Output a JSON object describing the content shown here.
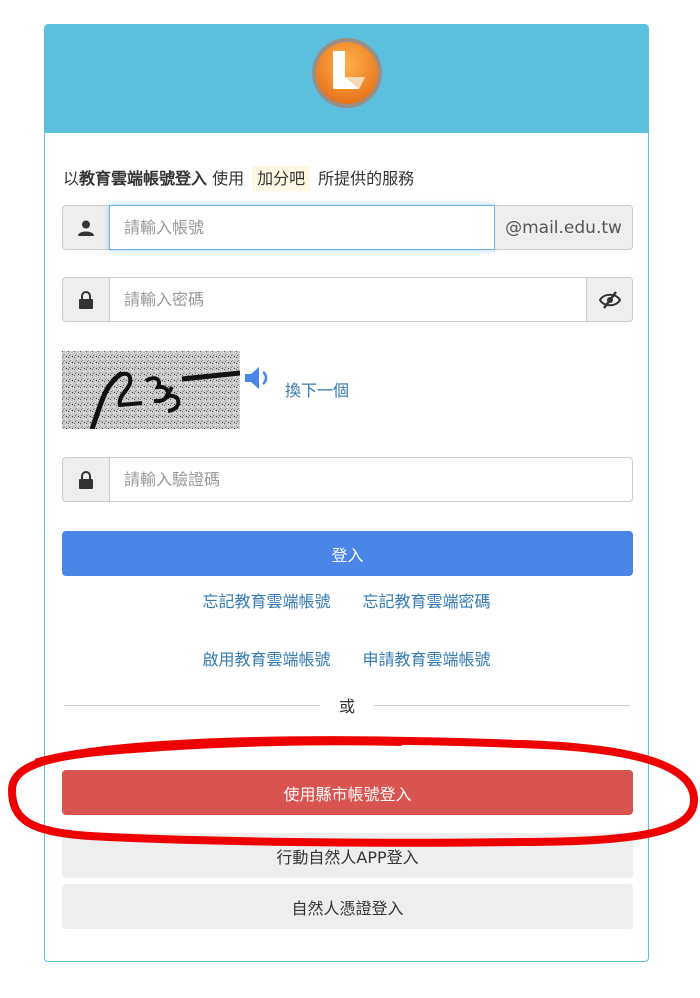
{
  "intro": {
    "prefix": "以",
    "bold": "教育雲端帳號登入",
    "mid": " 使用",
    "app_name": "加分吧",
    "suffix": "所提供的服務"
  },
  "account": {
    "placeholder": "請輸入帳號",
    "value": "",
    "domain_suffix": "@mail.edu.tw",
    "icon": "user-icon"
  },
  "password": {
    "placeholder": "請輸入密碼",
    "value": "",
    "icon": "lock-icon",
    "toggle_icon": "eye-slash-icon"
  },
  "captcha": {
    "refresh_label": "換下一個",
    "audio_icon": "speaker-icon",
    "placeholder": "請輸入驗證碼",
    "value": ""
  },
  "login_button": "登入",
  "links": {
    "forgot_account": "忘記教育雲端帳號",
    "forgot_password": "忘記教育雲端密碼",
    "activate_account": "啟用教育雲端帳號",
    "apply_account": "申請教育雲端帳號"
  },
  "divider_text": "或",
  "alt_logins": {
    "city_account": "使用縣市帳號登入",
    "mobile_app": "行動自然人APP登入",
    "citizen_cert": "自然人憑證登入"
  },
  "colors": {
    "header": "#5bc0de",
    "primary": "#4a86e8",
    "danger": "#d9534f",
    "annotation": "#ee0000"
  }
}
